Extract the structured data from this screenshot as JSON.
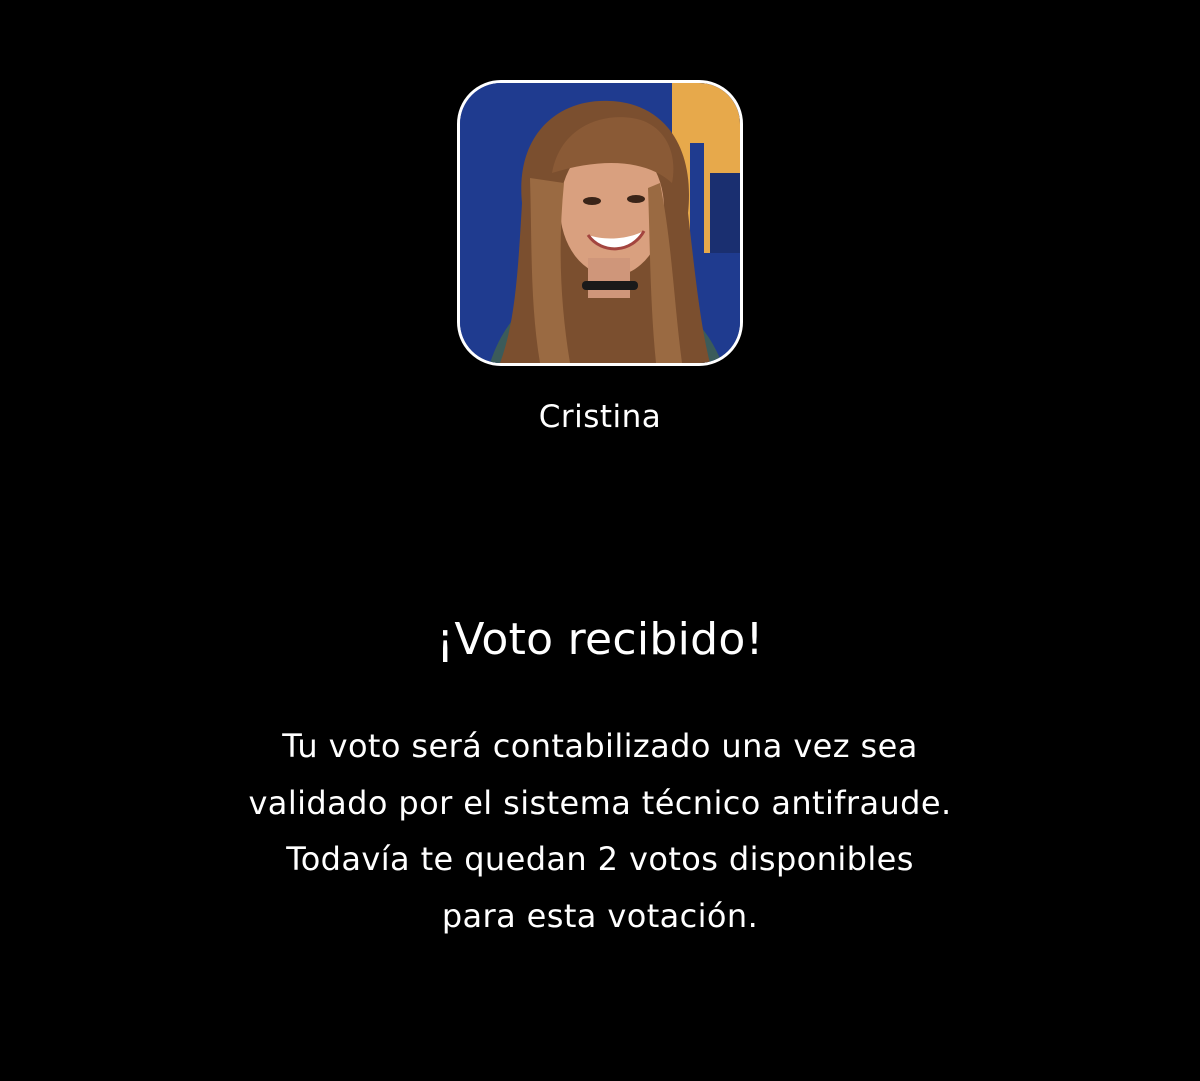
{
  "contestant": {
    "name": "Cristina",
    "photo_icon": "contestant-photo",
    "photo_colors": {
      "background": "#1f3b8f",
      "accent": "#e7a94b",
      "hair": "#8a5a36",
      "skin": "#d9a07f"
    }
  },
  "confirmation": {
    "title": "¡Voto recibido!",
    "message_lines": [
      "Tu voto será contabilizado una vez sea",
      "validado por el sistema técnico antifraude.",
      "Todavía te quedan 2 votos disponibles",
      "para esta votación."
    ]
  },
  "theme": {
    "background": "#000000",
    "text": "#ffffff"
  }
}
